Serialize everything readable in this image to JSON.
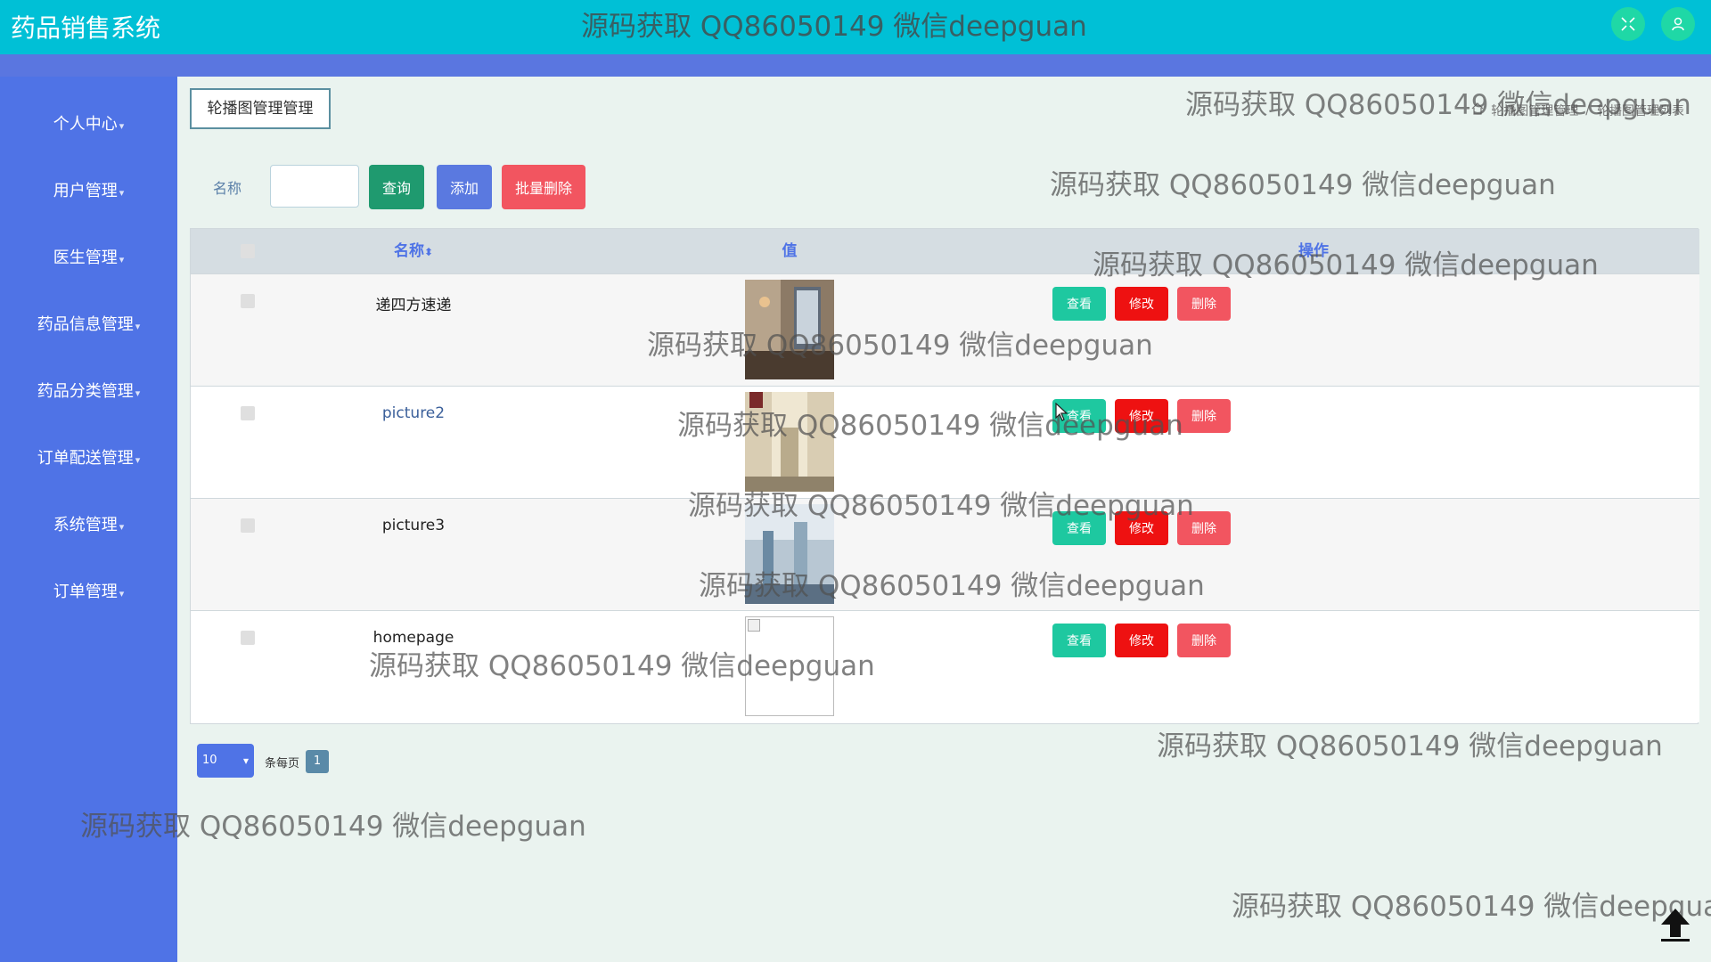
{
  "app": {
    "title": "药品销售系统"
  },
  "header": {
    "watermark": "源码获取 QQ86050149 微信deepguan"
  },
  "sidebar": {
    "items": [
      {
        "label": "个人中心"
      },
      {
        "label": "用户管理"
      },
      {
        "label": "医生管理"
      },
      {
        "label": "药品信息管理"
      },
      {
        "label": "药品分类管理"
      },
      {
        "label": "订单配送管理"
      },
      {
        "label": "系统管理"
      },
      {
        "label": "订单管理"
      }
    ]
  },
  "main": {
    "page_tab": "轮播图管理管理",
    "breadcrumb": {
      "level1": "轮播图管理管理",
      "level2": "轮播图管理列表"
    },
    "search": {
      "label": "名称",
      "input_value": "",
      "query_label": "查询",
      "add_label": "添加",
      "batch_delete_label": "批量删除"
    },
    "table": {
      "columns": {
        "name": "名称",
        "value": "值",
        "actions": "操作"
      },
      "rows": [
        {
          "name": "递四方速递"
        },
        {
          "name": "picture2"
        },
        {
          "name": "picture3"
        },
        {
          "name": "homepage"
        }
      ],
      "actions": {
        "view": "查看",
        "edit": "修改",
        "delete": "删除"
      }
    },
    "pagination": {
      "page_size": "10",
      "per_page_label": "条每页",
      "current_page": "1"
    }
  },
  "watermark_text": "源码获取 QQ86050149 微信deepguan",
  "colors": {
    "topbar": "#00c0d6",
    "sidebar": "#4f73e6",
    "view": "#1ec8a0",
    "edit": "#ee1111",
    "delete": "#f25560",
    "query": "#1f9a6f",
    "add": "#5a79e0",
    "batch_delete": "#f25560"
  }
}
